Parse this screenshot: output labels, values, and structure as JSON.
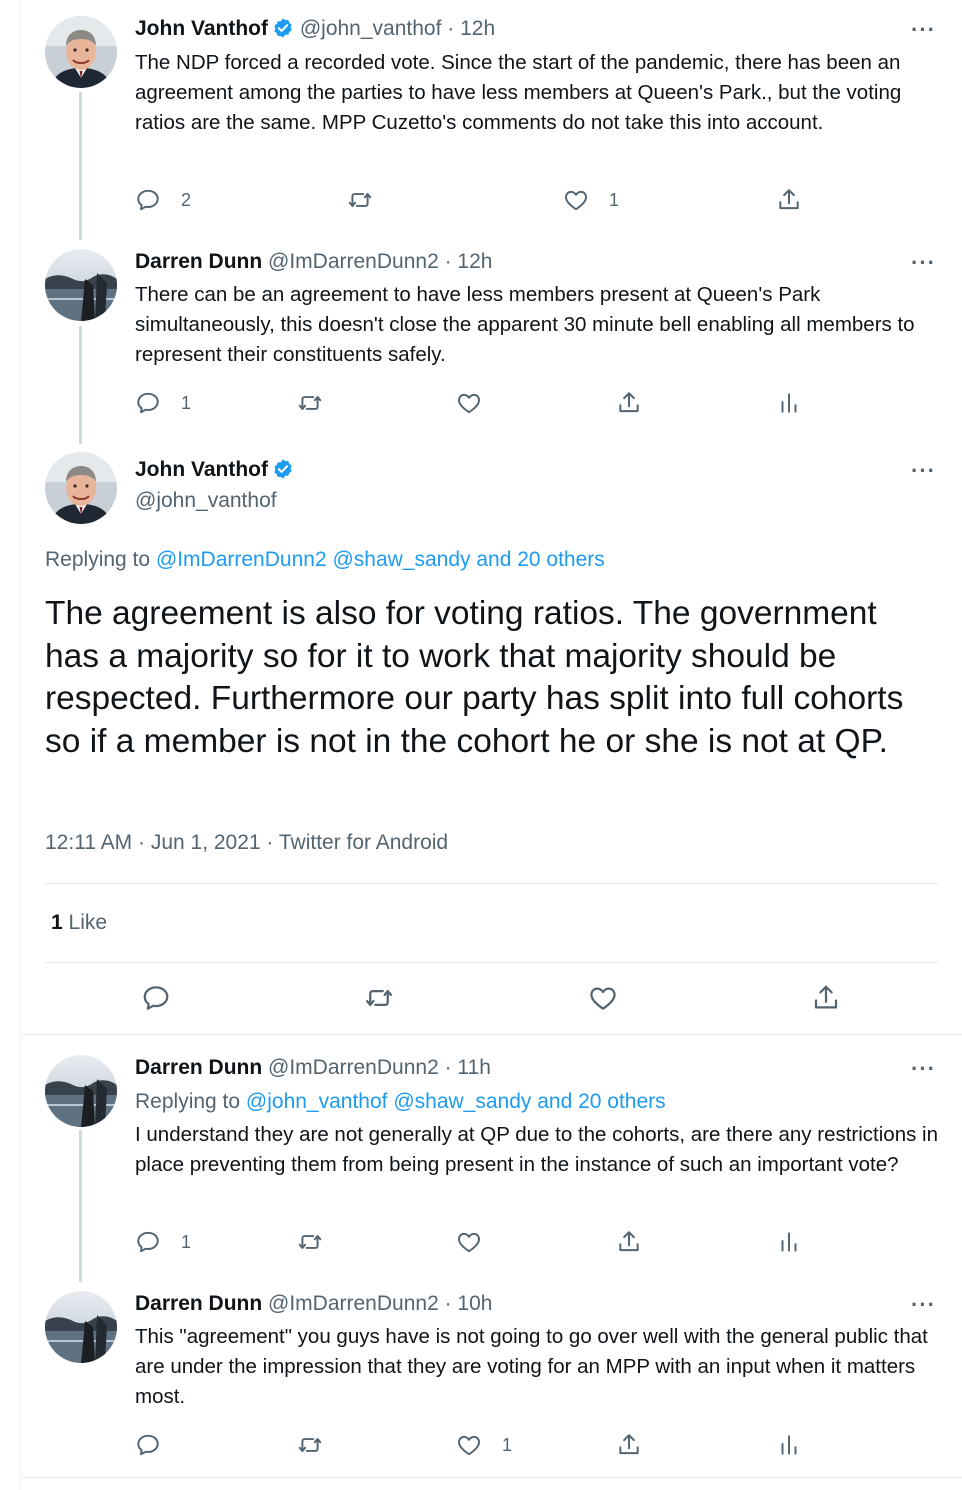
{
  "tweets": [
    {
      "name": "John Vanthof",
      "handle": "@john_vanthof",
      "time": "· 12h",
      "text": "The NDP forced a recorded vote.  Since the start of the pandemic, there has been an agreement among the parties to have less members at Queen's Park., but the voting ratios are the same. MPP  Cuzetto's comments do not take this into account.",
      "reply_count": "2",
      "retweet_count": "",
      "like_count": "1"
    },
    {
      "name": "Darren Dunn",
      "handle": "@ImDarrenDunn2",
      "time": "· 12h",
      "text": "There can be an agreement to have less members present at Queen's Park simultaneously, this doesn't close the apparent 30 minute bell enabling all members to represent their constituents safely.",
      "reply_count": "1",
      "retweet_count": "",
      "like_count": ""
    }
  ],
  "focused": {
    "name": "John Vanthof",
    "handle": "@john_vanthof",
    "replying_prefix": "Replying to",
    "replying_targets": "@ImDarrenDunn2 @shaw_sandy and 20 others",
    "text": "The agreement is also for voting ratios. The government has a majority so for it to work that majority should be respected. Furthermore our party has split into full cohorts so if a member is not in the cohort he or she is not at QP.",
    "meta": "12:11 AM · Jun 1, 2021 · Twitter for Android",
    "likes_count": "1",
    "likes_label": "Like"
  },
  "replies": [
    {
      "name": "Darren Dunn",
      "handle": "@ImDarrenDunn2",
      "time": "· 11h",
      "replying_prefix": "Replying to",
      "replying_targets": "@john_vanthof @shaw_sandy and 20 others",
      "text": "I understand they are not generally at QP due to the cohorts, are there any restrictions in place preventing them from being present in the instance of such an important vote?",
      "reply_count": "1",
      "like_count": ""
    },
    {
      "name": "Darren Dunn",
      "handle": "@ImDarrenDunn2",
      "time": "· 10h",
      "text": "This \"agreement\" you guys have is not going to go over well with the general public that are under the impression that they are voting for an MPP with an input when it matters most.",
      "reply_count": "",
      "like_count": "1"
    }
  ],
  "icons": {
    "more": "···",
    "verified": "verified-badge-icon",
    "reply": "reply-icon",
    "retweet": "retweet-icon",
    "like": "heart-icon",
    "share": "share-icon",
    "analytics": "analytics-icon"
  },
  "colors": {
    "accent": "#1d9bf0",
    "secondary_text": "#536471",
    "thread_line": "#cfd9de"
  }
}
